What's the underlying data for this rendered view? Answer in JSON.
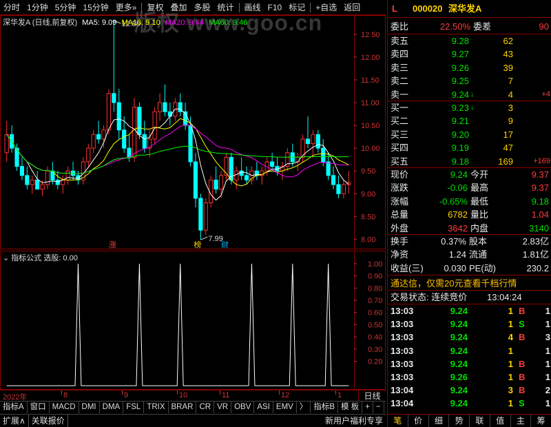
{
  "toolbar": {
    "items": [
      "分时",
      "1分钟",
      "5分钟",
      "15分钟",
      "更多»",
      "复权",
      "叠加",
      "多股",
      "统计",
      "画线",
      "F10",
      "标记",
      "+自选",
      "返回"
    ]
  },
  "watermark": "版权 www.goo.cn",
  "legend": {
    "title": "深华发A (日线,前复权)",
    "ma5": "MA5: 9.09",
    "ma10": "MA10: 9.10",
    "ma20": "MA20: 9.44",
    "ma60": "MA60: 9.46",
    "colors": {
      "ma5": "#ffffff",
      "ma10": "#ffff00",
      "ma20": "#ff00ff",
      "ma60": "#00ff00"
    }
  },
  "annotations": {
    "high": "12.80",
    "low": "7.99",
    "mark_zhang": "涨",
    "mark_bang": "榜",
    "mark_cai": "财"
  },
  "sub_legend": {
    "title": "指标公式",
    "value_label": "选股: 0.00"
  },
  "chart_data": [
    {
      "type": "candlestick",
      "title": "深华发A (日线,前复权)",
      "ylim": [
        7.9,
        12.8
      ],
      "y_ticks": [
        "12.50",
        "12.00",
        "11.50",
        "11.00",
        "10.50",
        "10.00",
        "9.50",
        "9.00",
        "8.50",
        "8.00"
      ],
      "x_ticks": [
        "2022年",
        "8",
        "9",
        "10",
        "11",
        "12",
        "1"
      ],
      "ohlc": [
        [
          9.9,
          10.6,
          9.7,
          10.3
        ],
        [
          10.3,
          10.5,
          9.9,
          10.0
        ],
        [
          10.0,
          10.1,
          9.5,
          9.6
        ],
        [
          9.6,
          9.8,
          9.3,
          9.4
        ],
        [
          9.4,
          9.6,
          9.1,
          9.2
        ],
        [
          9.2,
          9.4,
          9.0,
          9.3
        ],
        [
          9.3,
          9.5,
          9.1,
          9.1
        ],
        [
          9.1,
          9.3,
          8.95,
          9.2
        ],
        [
          9.2,
          9.6,
          9.1,
          9.5
        ],
        [
          9.5,
          9.7,
          9.2,
          9.3
        ],
        [
          9.3,
          9.5,
          9.1,
          9.2
        ],
        [
          9.2,
          9.4,
          9.0,
          9.3
        ],
        [
          9.3,
          9.6,
          9.2,
          9.5
        ],
        [
          9.5,
          9.7,
          9.3,
          9.4
        ],
        [
          9.4,
          9.5,
          9.2,
          9.3
        ],
        [
          9.3,
          9.8,
          9.2,
          9.7
        ],
        [
          9.7,
          10.1,
          9.6,
          10.0
        ],
        [
          10.0,
          10.4,
          9.9,
          10.3
        ],
        [
          10.3,
          10.6,
          10.1,
          10.2
        ],
        [
          10.2,
          10.5,
          10.0,
          10.4
        ],
        [
          10.4,
          11.3,
          10.3,
          11.2
        ],
        [
          11.2,
          12.8,
          10.8,
          11.0
        ],
        [
          11.0,
          11.3,
          10.2,
          10.4
        ],
        [
          10.4,
          10.7,
          9.9,
          10.0
        ],
        [
          10.0,
          10.3,
          9.7,
          9.8
        ],
        [
          9.8,
          11.1,
          9.7,
          10.9
        ],
        [
          10.9,
          11.0,
          10.2,
          10.3
        ],
        [
          10.3,
          10.6,
          9.9,
          10.0
        ],
        [
          10.0,
          10.4,
          9.8,
          10.2
        ],
        [
          10.2,
          10.9,
          10.1,
          10.8
        ],
        [
          10.8,
          11.2,
          10.6,
          11.0
        ],
        [
          11.0,
          11.4,
          10.7,
          10.8
        ],
        [
          10.8,
          11.0,
          10.5,
          10.7
        ],
        [
          10.7,
          11.1,
          10.6,
          11.0
        ],
        [
          11.0,
          11.2,
          10.7,
          10.8
        ],
        [
          10.8,
          11.0,
          10.4,
          10.5
        ],
        [
          10.5,
          10.7,
          9.6,
          9.7
        ],
        [
          9.7,
          9.9,
          8.7,
          8.9
        ],
        [
          8.9,
          9.0,
          7.99,
          8.2
        ],
        [
          8.2,
          8.9,
          8.1,
          8.8
        ],
        [
          8.8,
          9.4,
          8.7,
          9.3
        ],
        [
          9.3,
          9.6,
          9.0,
          9.1
        ],
        [
          9.1,
          9.5,
          8.9,
          9.4
        ],
        [
          9.4,
          9.9,
          9.3,
          9.8
        ],
        [
          9.8,
          9.9,
          9.2,
          9.3
        ],
        [
          9.3,
          9.6,
          9.1,
          9.5
        ],
        [
          9.5,
          9.8,
          9.3,
          9.4
        ],
        [
          9.4,
          9.6,
          9.2,
          9.3
        ],
        [
          9.3,
          9.6,
          9.2,
          9.5
        ],
        [
          9.5,
          9.7,
          9.3,
          9.4
        ],
        [
          9.4,
          9.6,
          9.2,
          9.5
        ],
        [
          9.5,
          9.8,
          9.4,
          9.7
        ],
        [
          9.7,
          9.9,
          9.5,
          9.6
        ],
        [
          9.6,
          9.8,
          9.4,
          9.5
        ],
        [
          9.5,
          9.7,
          9.3,
          9.6
        ],
        [
          9.6,
          10.0,
          9.5,
          9.9
        ],
        [
          9.9,
          10.1,
          9.6,
          9.7
        ],
        [
          9.7,
          9.9,
          9.5,
          9.8
        ],
        [
          9.8,
          10.3,
          9.7,
          10.2
        ],
        [
          10.2,
          10.7,
          10.0,
          10.1
        ],
        [
          10.1,
          10.4,
          9.8,
          10.3
        ],
        [
          10.3,
          10.4,
          9.9,
          10.0
        ],
        [
          10.0,
          10.2,
          9.6,
          9.7
        ],
        [
          9.7,
          9.9,
          9.3,
          9.4
        ],
        [
          9.4,
          9.6,
          9.1,
          9.2
        ],
        [
          9.2,
          9.4,
          8.9,
          9.0
        ],
        [
          9.0,
          9.3,
          8.9,
          9.2
        ],
        [
          9.2,
          9.5,
          9.0,
          9.24
        ]
      ],
      "ma_spec": [
        5,
        10,
        20,
        60
      ]
    },
    {
      "type": "line",
      "title": "指标公式",
      "ylim": [
        0,
        1.05
      ],
      "y_ticks": [
        "1.00",
        "0.90",
        "0.80",
        "0.70",
        "0.60",
        "0.50",
        "0.40",
        "0.30",
        "0.20"
      ],
      "spike_indices": [
        14,
        26,
        34,
        48,
        56,
        63
      ]
    }
  ],
  "date_axis_label": "日线",
  "tabs": [
    "指标A",
    "窗口",
    "MACD",
    "DMI",
    "DMA",
    "FSL",
    "TRIX",
    "BRAR",
    "CR",
    "VR",
    "OBV",
    "ASI",
    "EMV",
    "〉",
    "指标B",
    "模 板",
    "+",
    "−"
  ],
  "status": [
    "扩展∧",
    "关联报价"
  ],
  "status_right": "新用户福利专享",
  "panel": {
    "badge": "L",
    "code": "000020",
    "name": "深华发A",
    "weibi_label": "委比",
    "weibi": "22.50%",
    "weicha_label": "委差",
    "weicha": "90",
    "asks": [
      {
        "label": "卖五",
        "price": "9.28",
        "vol": "62",
        "extra": ""
      },
      {
        "label": "卖四",
        "price": "9.27",
        "vol": "43",
        "extra": ""
      },
      {
        "label": "卖三",
        "price": "9.26",
        "vol": "39",
        "extra": ""
      },
      {
        "label": "卖二",
        "price": "9.25",
        "vol": "7",
        "extra": ""
      },
      {
        "label": "卖一",
        "price": "9.24",
        "vol": "4",
        "extra": "+4",
        "arrow": "↓"
      }
    ],
    "bids": [
      {
        "label": "买一",
        "price": "9.23",
        "vol": "3",
        "extra": "",
        "arrow": "↓"
      },
      {
        "label": "买二",
        "price": "9.21",
        "vol": "9",
        "extra": ""
      },
      {
        "label": "买三",
        "price": "9.20",
        "vol": "17",
        "extra": ""
      },
      {
        "label": "买四",
        "price": "9.19",
        "vol": "47",
        "extra": ""
      },
      {
        "label": "买五",
        "price": "9.18",
        "vol": "169",
        "extra": "+169"
      }
    ],
    "quote": [
      {
        "l1": "现价",
        "v1": "9.24",
        "c1": "green",
        "l2": "今开",
        "v2": "9.37",
        "c2": "red"
      },
      {
        "l1": "涨跌",
        "v1": "-0.06",
        "c1": "green",
        "l2": "最高",
        "v2": "9.37",
        "c2": "red"
      },
      {
        "l1": "涨幅",
        "v1": "-0.65%",
        "c1": "green",
        "l2": "最低",
        "v2": "9.18",
        "c2": "green"
      },
      {
        "l1": "总量",
        "v1": "6782",
        "c1": "yellow",
        "l2": "量比",
        "v2": "1.04",
        "c2": "red"
      },
      {
        "l1": "外盘",
        "v1": "3642",
        "c1": "red",
        "l2": "内盘",
        "v2": "3140",
        "c2": "green"
      }
    ],
    "stats": [
      {
        "l1": "换手",
        "v1": "0.37%",
        "l2": "股本",
        "v2": "2.83亿"
      },
      {
        "l1": "净资",
        "v1": "1.24",
        "l2": "流通",
        "v2": "1.81亿"
      },
      {
        "l1": "收益(三)",
        "v1": "0.030",
        "l2": "PE(动)",
        "v2": "230.2"
      }
    ],
    "promo": "通达信，仅需20元查看千档行情",
    "trade_status_label": "交易状态: 连续竞价",
    "trade_time": "13:04:24",
    "ticks": [
      {
        "time": "13:03",
        "price": "9.24",
        "vol": "1",
        "side": "B",
        "num": "1"
      },
      {
        "time": "13:03",
        "price": "9.24",
        "vol": "1",
        "side": "S",
        "num": "1"
      },
      {
        "time": "13:03",
        "price": "9.24",
        "vol": "4",
        "side": "B",
        "num": "3"
      },
      {
        "time": "13:03",
        "price": "9.24",
        "vol": "1",
        "side": "",
        "num": "1"
      },
      {
        "time": "13:03",
        "price": "9.24",
        "vol": "1",
        "side": "B",
        "num": "1"
      },
      {
        "time": "13:03",
        "price": "9.26",
        "vol": "1",
        "side": "B",
        "num": "1"
      },
      {
        "time": "13:04",
        "price": "9.24",
        "vol": "3",
        "side": "B",
        "num": "2"
      },
      {
        "time": "13:04",
        "price": "9.24",
        "vol": "1",
        "side": "S",
        "num": "1"
      }
    ],
    "bottom_tabs": [
      "笔",
      "价",
      "细",
      "势",
      "联",
      "值",
      "主",
      "筹"
    ]
  }
}
